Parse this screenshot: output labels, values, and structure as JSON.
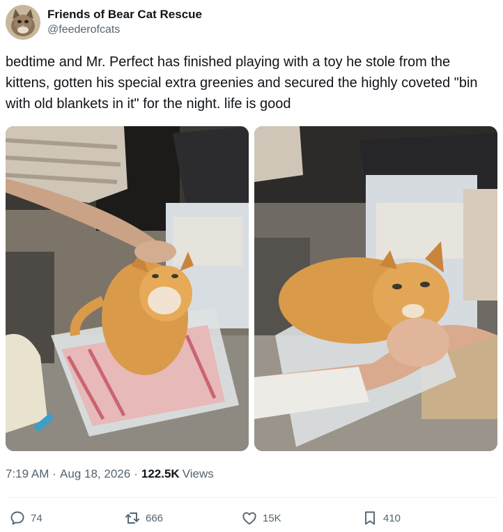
{
  "author": {
    "display_name": "Friends of Bear Cat Rescue",
    "handle": "@feederofcats",
    "avatar": "cat-avatar"
  },
  "tweet": {
    "text": "bedtime and Mr. Perfect has finished playing with a toy he stole from the kittens, gotten his special extra greenies and secured the highly coveted \"bin with old blankets in it\" for the night. life is good"
  },
  "media": {
    "photos": [
      {
        "subject": "orange cat sitting in plastic bin with pink blanket, hand petting head"
      },
      {
        "subject": "orange cat close-up in bin, hand scratching chin"
      }
    ]
  },
  "meta": {
    "time": "7:19 AM",
    "separator": "·",
    "date": "Aug 18, 2026",
    "views_count": "122.5K",
    "views_label": "Views"
  },
  "actions": {
    "replies": "74",
    "reposts": "666",
    "likes": "15K",
    "bookmarks": "410"
  },
  "colors": {
    "text_primary": "#0f1419",
    "text_secondary": "#536471",
    "divider": "#eff3f4"
  }
}
